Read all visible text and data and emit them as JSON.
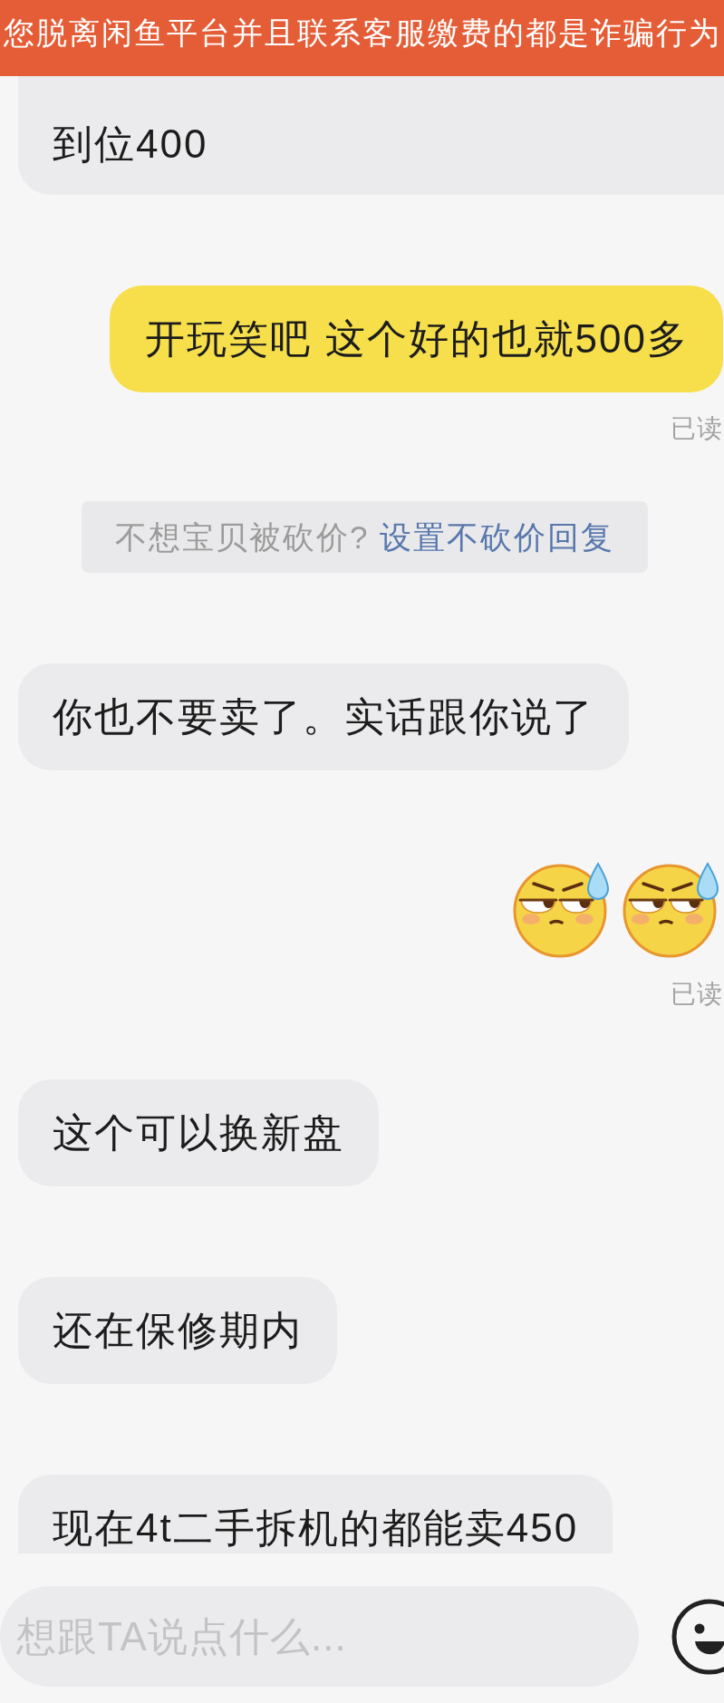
{
  "banner": {
    "text": "您脱离闲鱼平台并且联系客服缴费的都是诈骗行为"
  },
  "messages": [
    {
      "kind": "text",
      "outgoing": false,
      "text": "到位400"
    },
    {
      "kind": "text",
      "outgoing": true,
      "text": "开玩笑吧 这个好的也就500多",
      "status": "已读"
    },
    {
      "kind": "notice",
      "text": "不想宝贝被砍价?",
      "link": "设置不砍价回复"
    },
    {
      "kind": "text",
      "outgoing": false,
      "text": "你也不要卖了。实话跟你说了"
    },
    {
      "kind": "stickers",
      "outgoing": true,
      "stickers": [
        {
          "kind": "sweat"
        },
        {
          "kind": "sweat"
        }
      ],
      "status": "已读"
    },
    {
      "kind": "text",
      "outgoing": false,
      "text": "这个可以换新盘"
    },
    {
      "kind": "text",
      "outgoing": false,
      "text": "还在保修期内"
    },
    {
      "kind": "text",
      "outgoing": false,
      "text": "现在4t二手拆机的都能卖450"
    }
  ],
  "composer": {
    "placeholder": "想跟TA说点什么..."
  }
}
